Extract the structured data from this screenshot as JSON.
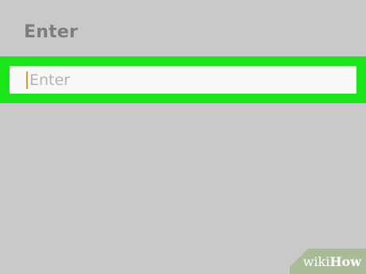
{
  "dialog": {
    "title": "Enter",
    "input": {
      "placeholder": "Enter",
      "value": ""
    }
  },
  "watermark": {
    "prefix": "wiki",
    "suffix": "How"
  },
  "colors": {
    "background": "#c9c9c9",
    "highlight": "#19e51a",
    "input_background": "#f8f8f8",
    "caret": "#c9a227",
    "title_text": "#7d7d7d",
    "placeholder_text": "#b3b3b3"
  }
}
